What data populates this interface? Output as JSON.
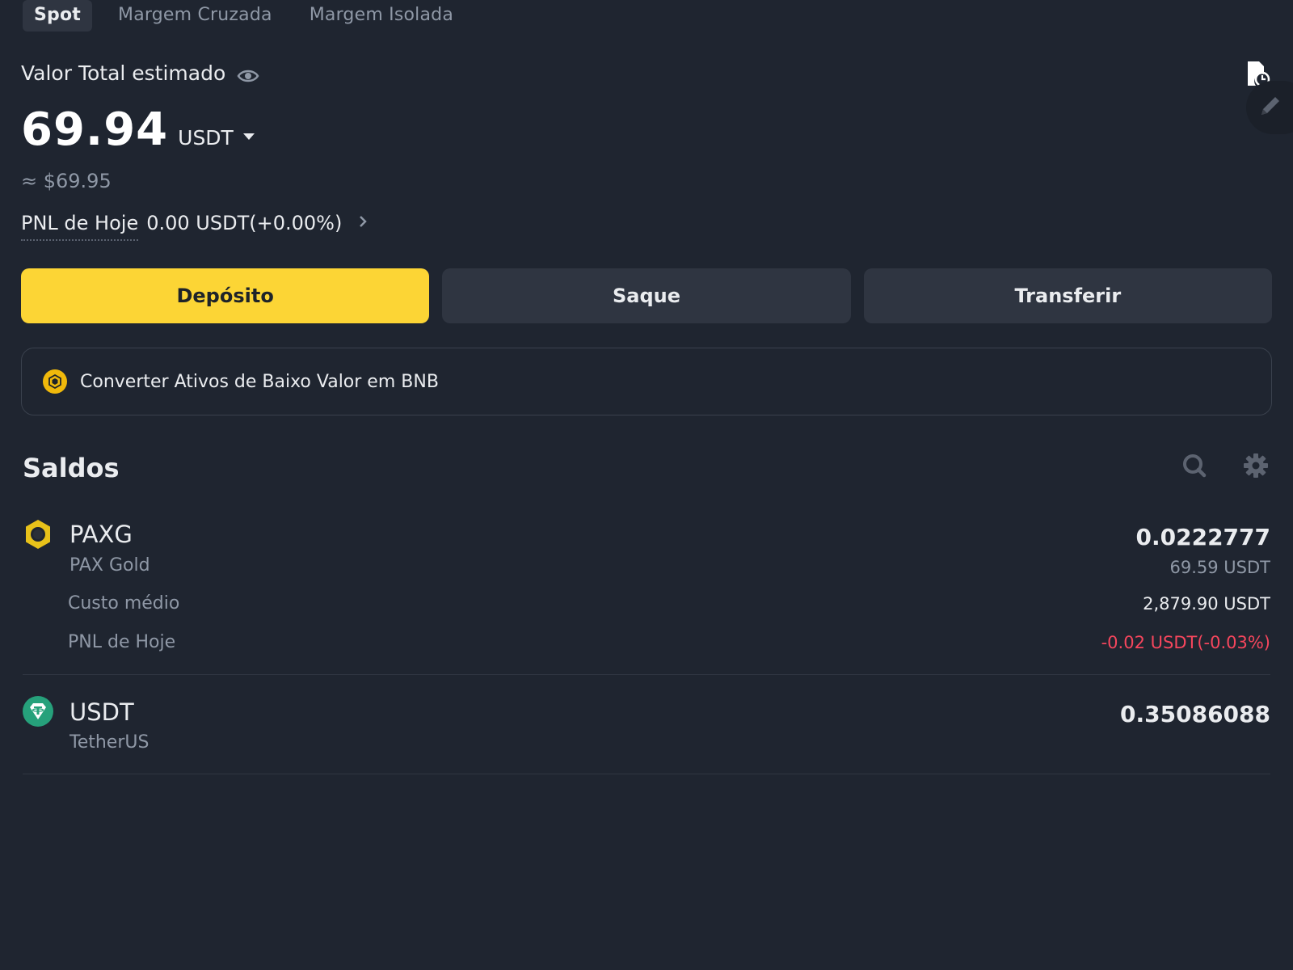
{
  "tabs": [
    {
      "label": "Spot",
      "active": true
    },
    {
      "label": "Margem Cruzada",
      "active": false
    },
    {
      "label": "Margem Isolada",
      "active": false
    }
  ],
  "header": {
    "total_label": "Valor Total estimado",
    "total_value": "69.94",
    "total_unit": "USDT",
    "usd_approx": "≈ $69.95",
    "pnl_label": "PNL de Hoje",
    "pnl_value": "0.00 USDT(+0.00%)"
  },
  "actions": {
    "deposit": "Depósito",
    "withdraw": "Saque",
    "transfer": "Transferir"
  },
  "banner": {
    "text": "Converter Ativos de Baixo Valor em BNB"
  },
  "balances": {
    "title": "Saldos",
    "assets": [
      {
        "symbol": "PAXG",
        "name": "PAX Gold",
        "amount": "0.0222777",
        "value": "69.59 USDT",
        "avg_cost_label": "Custo médio",
        "avg_cost_value": "2,879.90 USDT",
        "pnl_label": "PNL de Hoje",
        "pnl_value": "-0.02 USDT(-0.03%)"
      },
      {
        "symbol": "USDT",
        "name": "TetherUS",
        "amount": "0.35086088"
      }
    ]
  },
  "colors": {
    "background": "#1f2530",
    "accent": "#fcd535",
    "negative": "#f6465d",
    "muted": "#8f98a6"
  },
  "icons": [
    "eye-icon",
    "history-icon",
    "edit-icon",
    "chevron-right-icon",
    "bnb-icon",
    "search-icon",
    "gear-icon",
    "paxg-icon",
    "usdt-icon"
  ]
}
